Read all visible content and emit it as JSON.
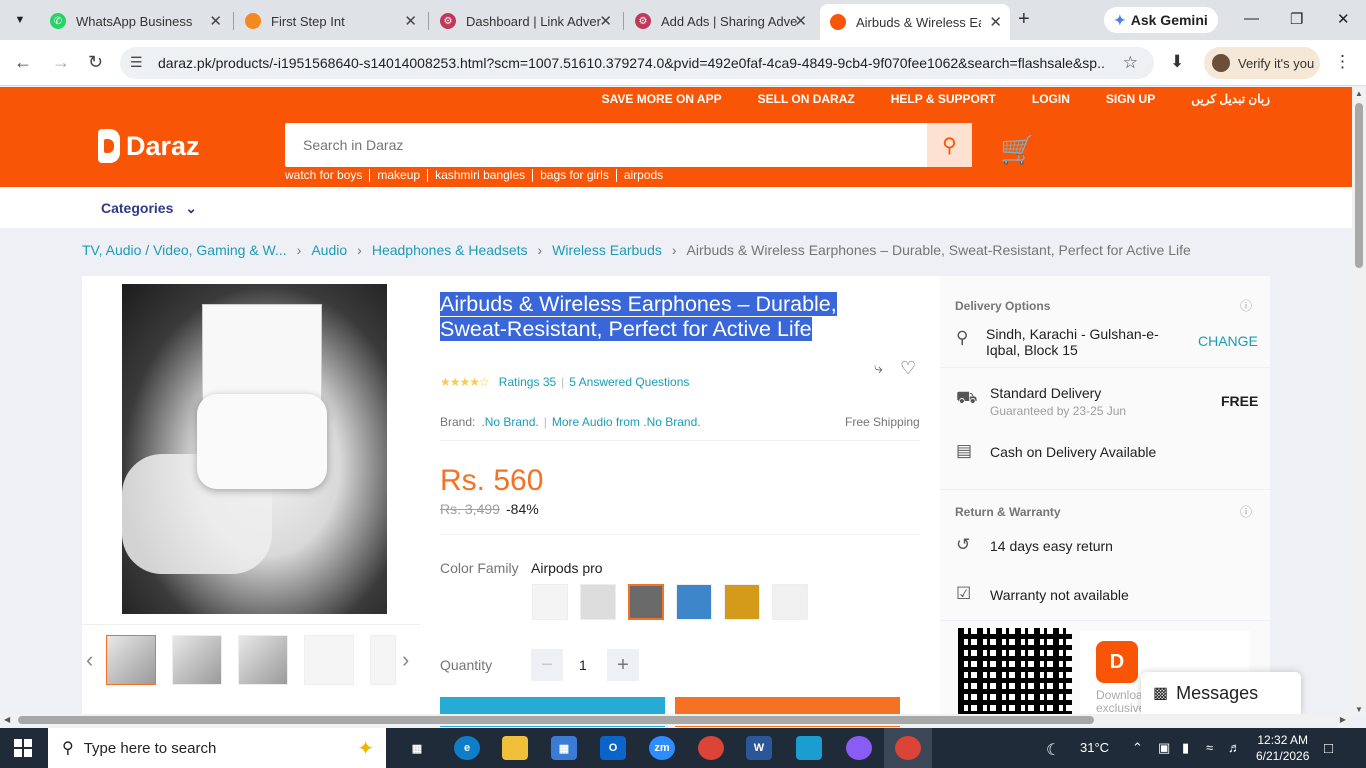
{
  "browser": {
    "tabs": [
      {
        "title": "WhatsApp Business",
        "color": "#25d366"
      },
      {
        "title": "First Step Int",
        "color": "#f5891f"
      },
      {
        "title": "Dashboard | Link Adver",
        "color": "#c0395b"
      },
      {
        "title": "Add Ads | Sharing Adve",
        "color": "#c0395b"
      },
      {
        "title": "Airbuds & Wireless Earp",
        "color": "#f85606"
      }
    ],
    "new_tab": "+",
    "gemini_label": "Ask Gemini",
    "url": "daraz.pk/products/-i1951568640-s14014008253.html?scm=1007.51610.379274.0&pvid=492e0faf-4ca9-4849-9cb4-9f070fee1062&search=flashsale&sp...",
    "verify_label": "Verify it's you"
  },
  "header": {
    "top_links": [
      "SAVE MORE ON APP",
      "SELL ON DARAZ",
      "HELP & SUPPORT",
      "LOGIN",
      "SIGN UP",
      "زبان تبدیل کریں"
    ],
    "logo_text": "Daraz",
    "search_placeholder": "Search in Daraz",
    "suggestions": [
      "watch for boys",
      "makeup",
      "kashmiri bangles",
      "bags for girls",
      "airpods"
    ],
    "brand_color": "#f85606"
  },
  "categories_label": "Categories",
  "breadcrumb": [
    "TV, Audio / Video, Gaming & W...",
    "Audio",
    "Headphones & Headsets",
    "Wireless Earbuds"
  ],
  "breadcrumb_current": "Airbuds & Wireless Earphones – Durable, Sweat-Resistant, Perfect for Active Life",
  "product": {
    "title": "Airbuds & Wireless Earphones – Durable, Sweat-Resistant, Perfect for Active Life",
    "rating_stars": 3.5,
    "ratings_text": "Ratings 35",
    "answered_questions": "5 Answered Questions",
    "brand_label": "Brand:",
    "brand_value": ".No Brand.",
    "more_from": "More Audio from .No Brand.",
    "free_shipping": "Free Shipping",
    "price": "Rs. 560",
    "old_price": "Rs. 3,499",
    "discount": "-84%",
    "color_label": "Color Family",
    "color_value": "Airpods pro",
    "quantity_label": "Quantity",
    "quantity": "1",
    "price_color": "#f57224"
  },
  "delivery": {
    "options_title": "Delivery Options",
    "address": "Sindh, Karachi - Gulshan-e-Iqbal, Block 15",
    "change": "CHANGE",
    "standard": "Standard Delivery",
    "guaranteed": "Guaranteed by 23-25 Jun",
    "free": "FREE",
    "cod": "Cash on Delivery Available",
    "return_title": "Return & Warranty",
    "return": "14 days easy return",
    "warranty": "Warranty not available",
    "app_text": "Download exclusive"
  },
  "messages_label": "Messages",
  "taskbar": {
    "search_placeholder": "Type here to search",
    "temperature": "31°C",
    "time": "12:32 AM",
    "date": "6/21/2026"
  }
}
